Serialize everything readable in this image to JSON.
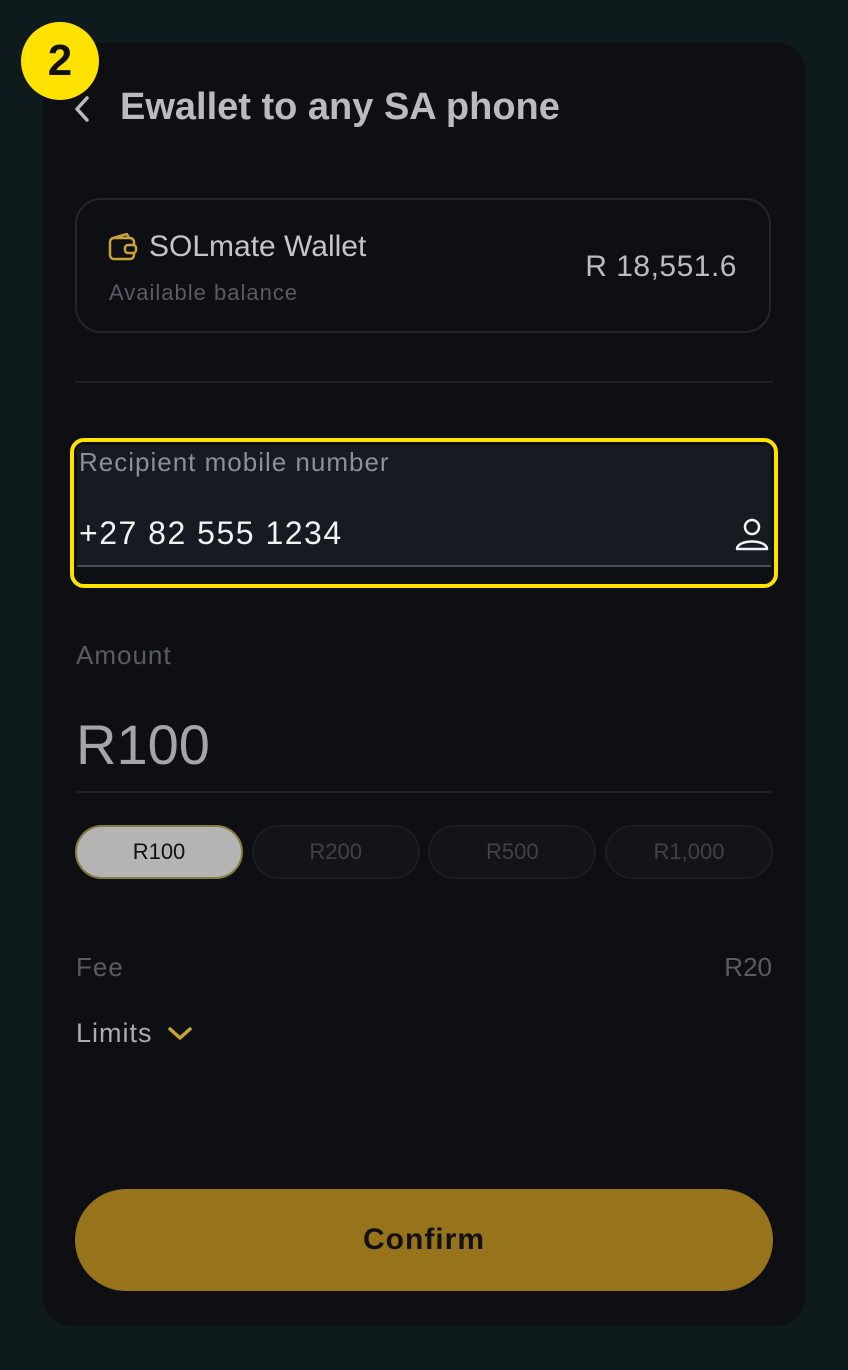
{
  "step_badge": "2",
  "header": {
    "title": "Ewallet to any SA phone"
  },
  "wallet": {
    "name": "SOLmate Wallet",
    "subtitle": "Available balance",
    "balance": "R 18,551.6"
  },
  "recipient": {
    "label": "Recipient mobile number",
    "value": "+27 82 555 1234"
  },
  "amount": {
    "label": "Amount",
    "value": "R100",
    "presets": [
      "R100",
      "R200",
      "R500",
      "R1,000"
    ],
    "selected_index": 0
  },
  "fee": {
    "label": "Fee",
    "value": "R20"
  },
  "limits": {
    "label": "Limits"
  },
  "confirm": {
    "label": "Confirm"
  },
  "colors": {
    "accent": "#97741c",
    "highlight": "#ffe200",
    "background": "#0d0f13"
  }
}
